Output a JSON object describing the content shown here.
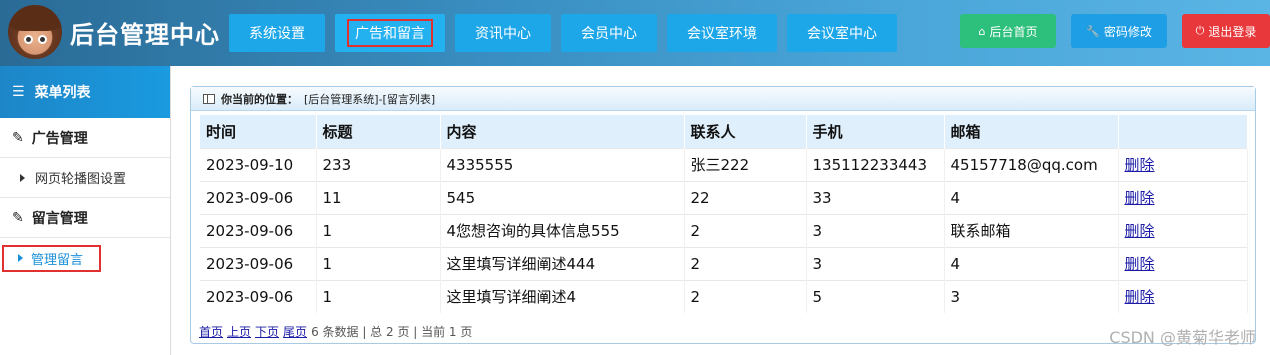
{
  "header": {
    "title": "后台管理中心",
    "nav": [
      {
        "label": "系统设置"
      },
      {
        "label": "广告和留言"
      },
      {
        "label": "资讯中心"
      },
      {
        "label": "会员中心"
      },
      {
        "label": "会议室环境"
      },
      {
        "label": "会议室中心"
      }
    ],
    "tools": [
      {
        "label": "后台首页",
        "icon": "home-icon",
        "color": "#2dc07c"
      },
      {
        "label": "密码修改",
        "icon": "wrench-icon",
        "color": "#1e9fe5"
      },
      {
        "label": "退出登录",
        "icon": "power-icon",
        "color": "#e8383b"
      }
    ]
  },
  "sidebar": {
    "title": "菜单列表",
    "groups": [
      {
        "label": "广告管理",
        "items": [
          {
            "label": "网页轮播图设置"
          }
        ]
      },
      {
        "label": "留言管理",
        "items": [
          {
            "label": "管理留言"
          }
        ]
      }
    ]
  },
  "panel": {
    "location_label": "你当前的位置：",
    "location_path": "[后台管理系统]-[留言列表]",
    "columns": [
      "时间",
      "标题",
      "内容",
      "联系人",
      "手机",
      "邮箱",
      ""
    ],
    "rows": [
      [
        "2023-09-10",
        "233",
        "4335555",
        "张三222",
        "135112233443",
        "45157718@qq.com",
        "删除"
      ],
      [
        "2023-09-06",
        "11",
        "545",
        "22",
        "33",
        "4",
        "删除"
      ],
      [
        "2023-09-06",
        "1",
        "4您想咨询的具体信息555",
        "2",
        "3",
        "联系邮箱",
        "删除"
      ],
      [
        "2023-09-06",
        "1",
        "这里填写详细阐述444",
        "2",
        "3",
        "4",
        "删除"
      ],
      [
        "2023-09-06",
        "1",
        "这里填写详细阐述4",
        "2",
        "5",
        "3",
        "删除"
      ]
    ],
    "pager": {
      "first": "首页",
      "prev": "上页",
      "next": "下页",
      "last": "尾页",
      "info": "6 条数据 | 总 2 页 | 当前 1 页"
    }
  },
  "watermark": "CSDN @黄菊华老师"
}
